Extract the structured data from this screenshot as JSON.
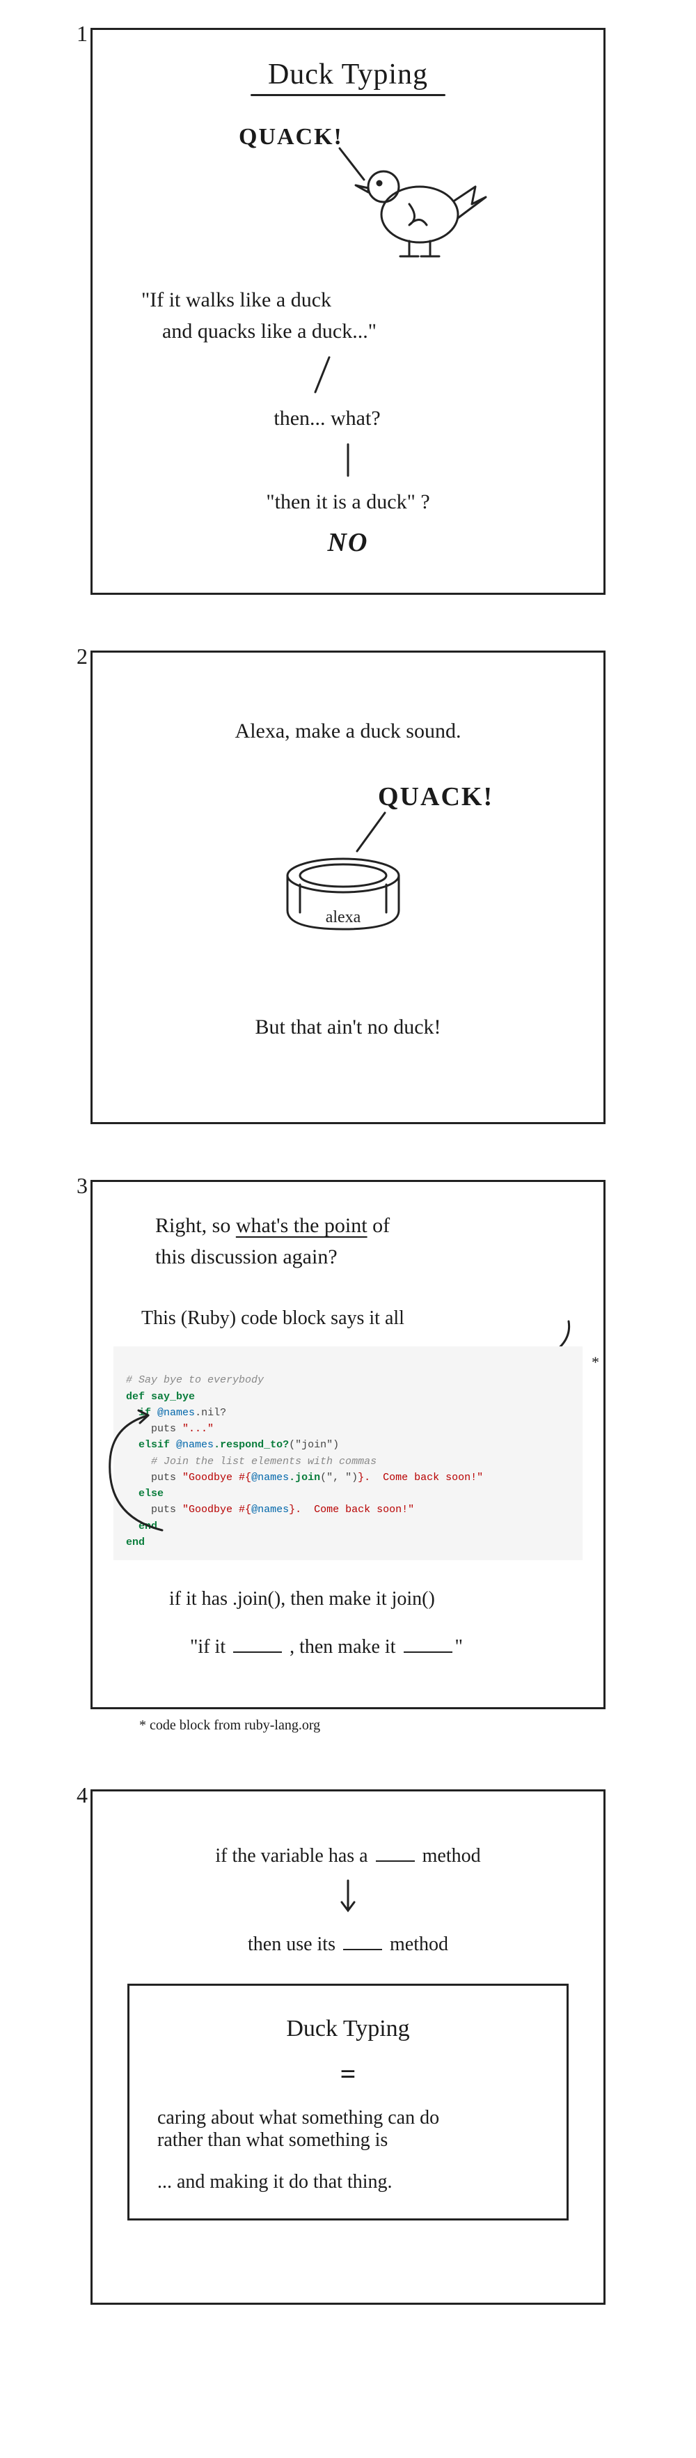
{
  "panel1": {
    "num": "1",
    "title": "Duck Typing",
    "quack": "QUACK!",
    "saying_line1": "\"If it walks like a duck",
    "saying_line2": "and quacks like a duck...\"",
    "then_what": "then... what?",
    "then_it_is": "\"then it is a duck\" ?",
    "no": "NO"
  },
  "panel2": {
    "num": "2",
    "command": "Alexa, make a duck sound.",
    "quack": "QUACK!",
    "device_label": "alexa",
    "caption": "But that ain't no duck!"
  },
  "panel3": {
    "num": "3",
    "line1_a": "Right, so ",
    "line1_u": "what's the point",
    "line1_b": " of",
    "line2": "this discussion again?",
    "intro": "This (Ruby) code block says it all",
    "code": {
      "c1": "# Say bye to everybody",
      "def": "def",
      "fname": "say_bye",
      "if": "if",
      "names": "@names",
      "nilq": ".nil?",
      "puts1": "puts",
      "str1": "\"...\"",
      "elsif": "elsif",
      "respond": ".respond_to?",
      "joinarg": "(\"join\")",
      "c2": "# Join the list elements with commas",
      "puts2": "puts",
      "str2a": "\"Goodbye #{",
      "joincall": ".join",
      "joinargs": "(\", \")",
      "str2b": "}.  Come back soon!\"",
      "else": "else",
      "puts3": "puts",
      "str3a": "\"Goodbye #{",
      "str3b": "}.  Come back soon!\"",
      "end1": "end",
      "end2": "end"
    },
    "summary1": "if it has .join(), then make it join()",
    "summary2_a": "\"if it ",
    "summary2_b": " , then make it ",
    "summary2_c": "\"",
    "asterisk": "*",
    "footnote": "* code block from ruby-lang.org"
  },
  "panel4": {
    "num": "4",
    "line1_a": "if the variable has a ",
    "line1_b": " method",
    "line2_a": "then use its ",
    "line2_b": " method",
    "box_title": "Duck Typing",
    "eq": "=",
    "box_line1": "caring about what something can do",
    "box_line2": "rather than what something is",
    "box_line3": "... and making it do that thing."
  }
}
